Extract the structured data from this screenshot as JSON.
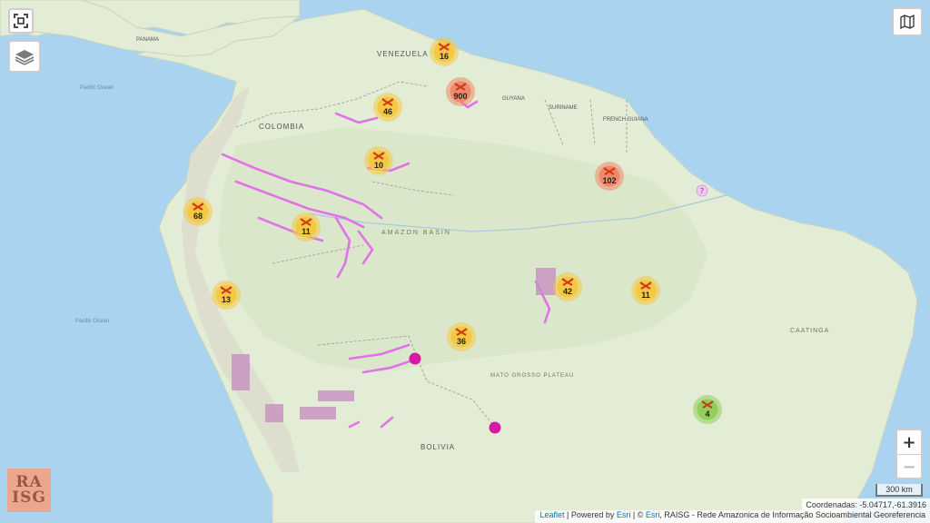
{
  "map": {
    "countries": [
      "VENEZUELA",
      "COLOMBIA",
      "GUYANA",
      "SURINAME",
      "FRENCH GUIANA",
      "BOLIVIA",
      "PANAMA"
    ],
    "features": [
      "AMAZON BASIN",
      "MATO GROSSO PLATEAU",
      "CAATINGA",
      "Pacific Ocean",
      "Pacific Ocean"
    ],
    "clusters": [
      {
        "count": "16",
        "color": "#f5c842"
      },
      {
        "count": "900",
        "color": "#ee8a6a"
      },
      {
        "count": "46",
        "color": "#f5c842"
      },
      {
        "count": "10",
        "color": "#f5c842"
      },
      {
        "count": "102",
        "color": "#ee8a6a"
      },
      {
        "count": "68",
        "color": "#f5c842"
      },
      {
        "count": "11",
        "color": "#f5c842"
      },
      {
        "count": "13",
        "color": "#f5c842"
      },
      {
        "count": "42",
        "color": "#f5c842"
      },
      {
        "count": "11",
        "color": "#f5c842"
      },
      {
        "count": "36",
        "color": "#f5c842"
      },
      {
        "count": "4",
        "color": "#8fcf5a"
      }
    ],
    "unknown_marker": "?",
    "mining_icon": "pickaxe-hammer-icon"
  },
  "controls": {
    "fullscreen_icon": "fullscreen-icon",
    "layers_icon": "layers-icon",
    "basemap_icon": "map-icon",
    "zoom_in": "+",
    "zoom_out": "−"
  },
  "scale": {
    "label": "300 km"
  },
  "coordinates": {
    "text": "Coordenadas: -5.04717,-61.3916"
  },
  "attribution": {
    "leaflet": "Leaflet",
    "sep1": " | Powered by ",
    "esri": "Esri",
    "sep2": " | © ",
    "esri2": "Esri",
    "rest": ", RAISG - Rede Amazonica de Informação Socioambiental Georeferencia"
  },
  "logo": {
    "line1": "RA",
    "line2": "ISG"
  }
}
